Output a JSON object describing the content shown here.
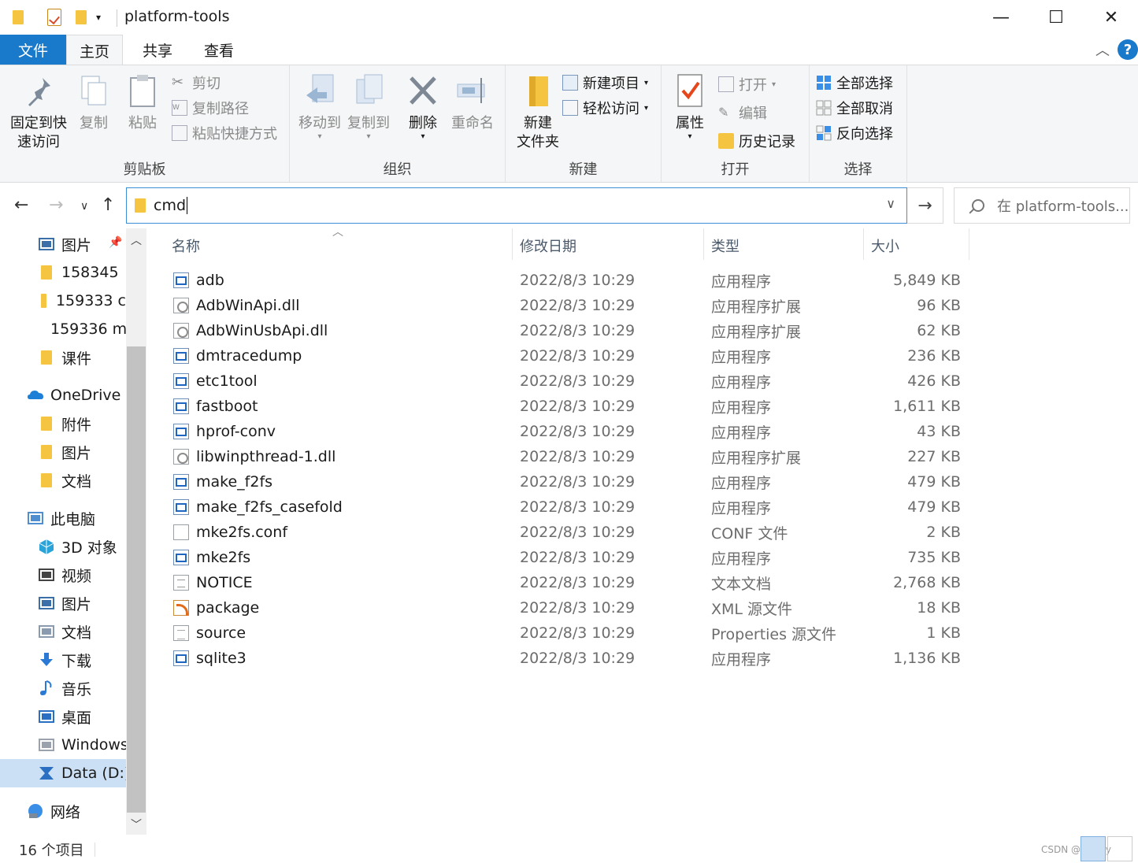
{
  "window": {
    "title": "platform-tools",
    "minimize": "—",
    "maximize": "☐",
    "close": "✕"
  },
  "tabs": {
    "file": "文件",
    "home": "主页",
    "share": "共享",
    "view": "查看"
  },
  "ribbon": {
    "clipboard": {
      "label": "剪贴板",
      "pin_line1": "固定到快",
      "pin_line2": "速访问",
      "copy": "复制",
      "paste": "粘贴",
      "cut": "剪切",
      "copy_path": "复制路径",
      "paste_shortcut": "粘贴快捷方式"
    },
    "organize": {
      "label": "组织",
      "move_to": "移动到",
      "copy_to": "复制到",
      "delete": "删除",
      "rename": "重命名"
    },
    "new": {
      "label": "新建",
      "new_folder_line1": "新建",
      "new_folder_line2": "文件夹",
      "new_item": "新建项目",
      "easy_access": "轻松访问"
    },
    "open": {
      "label": "打开",
      "properties": "属性",
      "open": "打开",
      "edit": "编辑",
      "history": "历史记录"
    },
    "select": {
      "label": "选择",
      "select_all": "全部选择",
      "select_none": "全部取消",
      "invert": "反向选择"
    }
  },
  "address": {
    "value": "cmd",
    "search_placeholder": "在 platform-tools..."
  },
  "sidebar": {
    "items": [
      {
        "label": "图片",
        "icon": "pictures-icon"
      },
      {
        "label": "158345",
        "icon": "folder-icon"
      },
      {
        "label": "159333 c",
        "icon": "folder-icon"
      },
      {
        "label": "159336 m",
        "icon": "folder-icon"
      },
      {
        "label": "课件",
        "icon": "folder-icon"
      },
      {
        "label": "OneDrive -",
        "icon": "onedrive-icon"
      },
      {
        "label": "附件",
        "icon": "folder-icon"
      },
      {
        "label": "图片",
        "icon": "folder-icon"
      },
      {
        "label": "文档",
        "icon": "folder-icon"
      },
      {
        "label": "此电脑",
        "icon": "computer-icon"
      },
      {
        "label": "3D 对象",
        "icon": "3d-objects-icon"
      },
      {
        "label": "视频",
        "icon": "video-icon"
      },
      {
        "label": "图片",
        "icon": "pictures-icon"
      },
      {
        "label": "文档",
        "icon": "documents-icon"
      },
      {
        "label": "下载",
        "icon": "download-icon"
      },
      {
        "label": "音乐",
        "icon": "music-icon"
      },
      {
        "label": "桌面",
        "icon": "desktop-icon"
      },
      {
        "label": "Windows",
        "icon": "drive-icon"
      },
      {
        "label": "Data (D:)",
        "icon": "data-drive-icon"
      },
      {
        "label": "网络",
        "icon": "network-icon"
      }
    ]
  },
  "columns": {
    "name": "名称",
    "date": "修改日期",
    "type": "类型",
    "size": "大小"
  },
  "files": [
    {
      "name": "adb",
      "date": "2022/8/3 10:29",
      "type": "应用程序",
      "size": "5,849 KB",
      "icon": "app"
    },
    {
      "name": "AdbWinApi.dll",
      "date": "2022/8/3 10:29",
      "type": "应用程序扩展",
      "size": "96 KB",
      "icon": "dll"
    },
    {
      "name": "AdbWinUsbApi.dll",
      "date": "2022/8/3 10:29",
      "type": "应用程序扩展",
      "size": "62 KB",
      "icon": "dll"
    },
    {
      "name": "dmtracedump",
      "date": "2022/8/3 10:29",
      "type": "应用程序",
      "size": "236 KB",
      "icon": "app"
    },
    {
      "name": "etc1tool",
      "date": "2022/8/3 10:29",
      "type": "应用程序",
      "size": "426 KB",
      "icon": "app"
    },
    {
      "name": "fastboot",
      "date": "2022/8/3 10:29",
      "type": "应用程序",
      "size": "1,611 KB",
      "icon": "app"
    },
    {
      "name": "hprof-conv",
      "date": "2022/8/3 10:29",
      "type": "应用程序",
      "size": "43 KB",
      "icon": "app"
    },
    {
      "name": "libwinpthread-1.dll",
      "date": "2022/8/3 10:29",
      "type": "应用程序扩展",
      "size": "227 KB",
      "icon": "dll"
    },
    {
      "name": "make_f2fs",
      "date": "2022/8/3 10:29",
      "type": "应用程序",
      "size": "479 KB",
      "icon": "app"
    },
    {
      "name": "make_f2fs_casefold",
      "date": "2022/8/3 10:29",
      "type": "应用程序",
      "size": "479 KB",
      "icon": "app"
    },
    {
      "name": "mke2fs.conf",
      "date": "2022/8/3 10:29",
      "type": "CONF 文件",
      "size": "2 KB",
      "icon": "doc"
    },
    {
      "name": "mke2fs",
      "date": "2022/8/3 10:29",
      "type": "应用程序",
      "size": "735 KB",
      "icon": "app"
    },
    {
      "name": "NOTICE",
      "date": "2022/8/3 10:29",
      "type": "文本文档",
      "size": "2,768 KB",
      "icon": "txt"
    },
    {
      "name": "package",
      "date": "2022/8/3 10:29",
      "type": "XML 源文件",
      "size": "18 KB",
      "icon": "xml"
    },
    {
      "name": "source",
      "date": "2022/8/3 10:29",
      "type": "Properties 源文件",
      "size": "1 KB",
      "icon": "prop"
    },
    {
      "name": "sqlite3",
      "date": "2022/8/3 10:29",
      "type": "应用程序",
      "size": "1,136 KB",
      "icon": "app"
    }
  ],
  "status": {
    "count": "16 个项目",
    "watermark": "CSDN @Doggy"
  },
  "colors": {
    "accent": "#1979ca",
    "ribbon_bg": "#f5f6f7",
    "selection": "#cce0f5",
    "folder": "#f5c542"
  }
}
